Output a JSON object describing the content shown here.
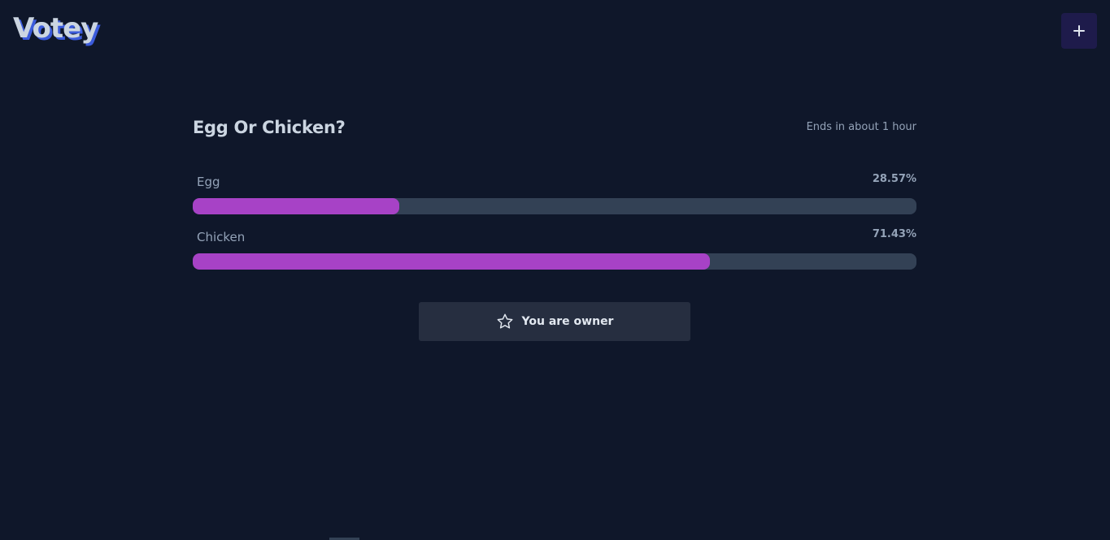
{
  "app": {
    "title": "Votey"
  },
  "header": {
    "add_icon": "plus-icon"
  },
  "poll": {
    "title": "Egg Or Chicken?",
    "ends": "Ends in about 1 hour",
    "options": [
      {
        "label": "Egg",
        "percent_text": "28.57%",
        "percent": 28.57
      },
      {
        "label": "Chicken",
        "percent_text": "71.43%",
        "percent": 71.43
      }
    ]
  },
  "owner": {
    "icon": "star-icon",
    "label": "You are owner"
  },
  "colors": {
    "background": "#0f172a",
    "bar_fill": "#a742c6",
    "bar_track": "#334155",
    "logo_shadow": "#3b5bdb"
  }
}
